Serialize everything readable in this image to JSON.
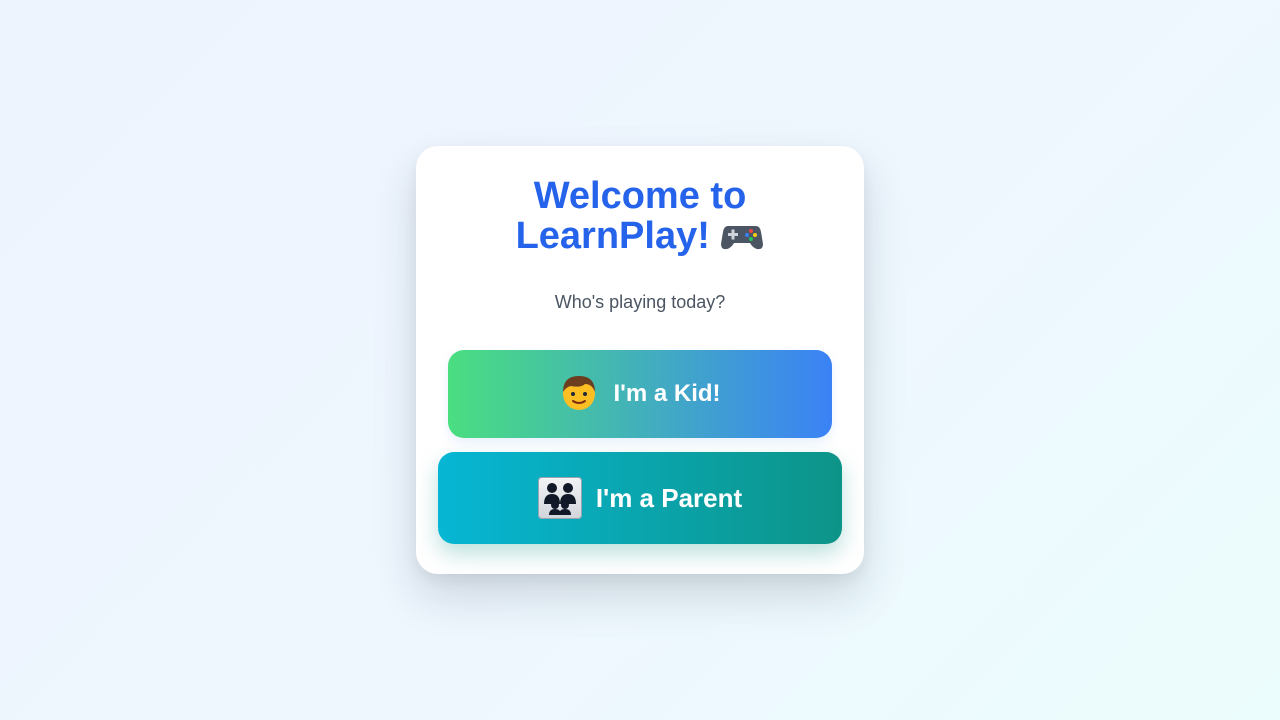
{
  "welcome": {
    "title_line1": "Welcome to",
    "title_line2": "LearnPlay!",
    "title_icon": "video-game-controller-icon",
    "subtitle": "Who's playing today?"
  },
  "roles": {
    "kid": {
      "label": "I'm a Kid!",
      "icon": "boy-icon"
    },
    "parent": {
      "label": "I'm a Parent",
      "icon": "family-icon"
    }
  },
  "colors": {
    "title": "#2563eb",
    "kid_gradient": [
      "#4ade80",
      "#3b82f6"
    ],
    "parent_gradient": [
      "#06b6d4",
      "#0d9488"
    ]
  }
}
